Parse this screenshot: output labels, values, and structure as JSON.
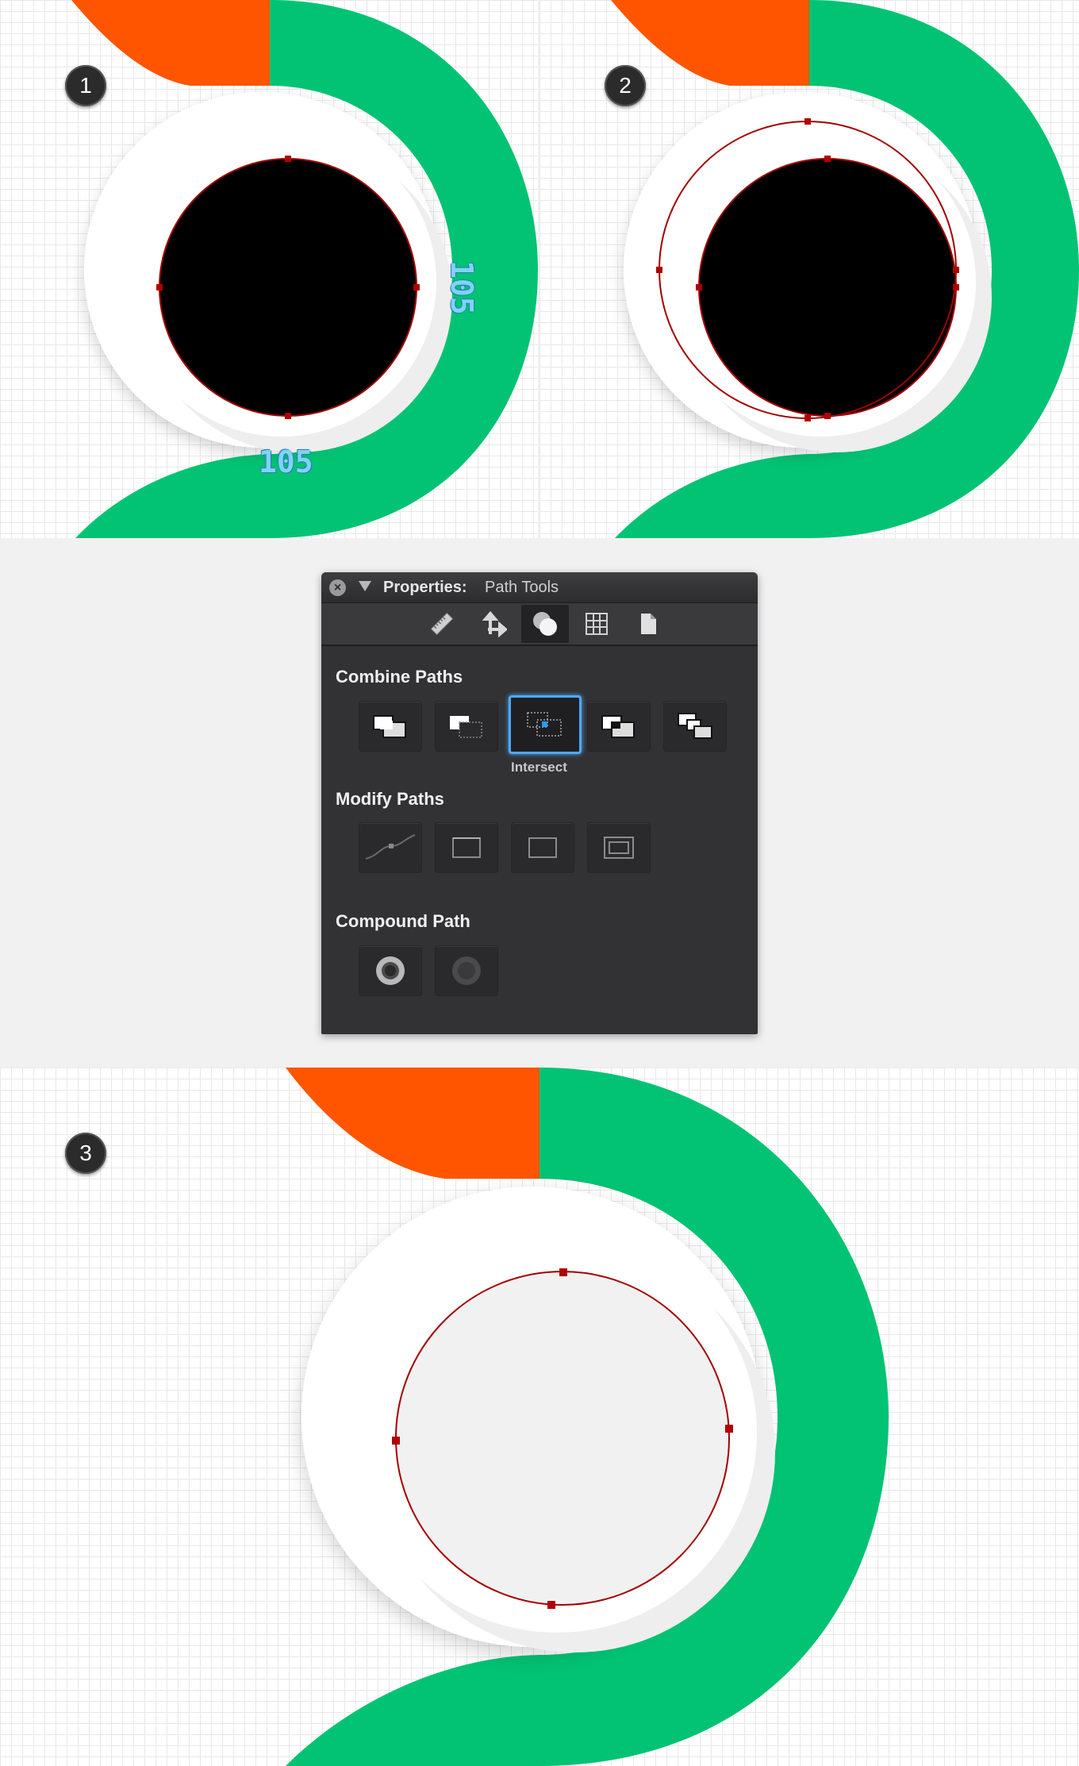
{
  "steps": {
    "step1": {
      "badge": "1",
      "dim_horizontal": "105",
      "dim_vertical": "105"
    },
    "step2": {
      "badge": "2"
    },
    "step3": {
      "badge": "3"
    }
  },
  "colors": {
    "green": "#02c373",
    "orange": "#ff5500",
    "black_circle": "#000000",
    "path_outline": "#a40000",
    "dim_text": "#7fd3f5",
    "selection_blue": "#4fa8ff"
  },
  "properties_panel": {
    "title_bold": "Properties:",
    "title_sub": "Path Tools",
    "tabs": [
      {
        "icon": "ruler-icon"
      },
      {
        "icon": "move-arrows-icon"
      },
      {
        "icon": "path-tools-icon",
        "active": true
      },
      {
        "icon": "grid-icon"
      },
      {
        "icon": "document-icon"
      }
    ],
    "combine_paths": {
      "title": "Combine Paths",
      "buttons": [
        {
          "icon": "add-icon"
        },
        {
          "icon": "subtract-icon"
        },
        {
          "icon": "intersect-icon",
          "selected": true,
          "caption": "Intersect"
        },
        {
          "icon": "exclude-icon"
        },
        {
          "icon": "divide-icon"
        }
      ]
    },
    "modify_paths": {
      "title": "Modify Paths",
      "buttons": [
        {
          "icon": "simplify-curve-icon"
        },
        {
          "icon": "rectangle-icon"
        },
        {
          "icon": "rectangle-outline-icon"
        },
        {
          "icon": "offset-rectangle-icon"
        }
      ]
    },
    "compound_path": {
      "title": "Compound Path",
      "buttons": [
        {
          "icon": "make-compound-icon"
        },
        {
          "icon": "release-compound-icon"
        }
      ]
    }
  }
}
